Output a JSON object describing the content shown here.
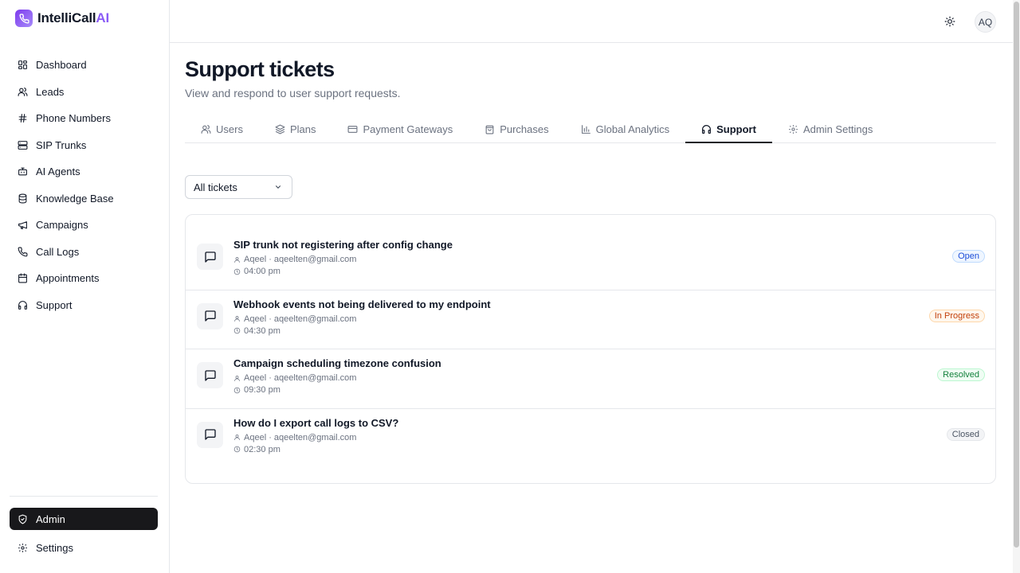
{
  "brand": {
    "name_main": "IntelliCall",
    "name_accent": "AI"
  },
  "sidebar": {
    "items": [
      {
        "label": "Dashboard",
        "icon": "dashboard-icon"
      },
      {
        "label": "Leads",
        "icon": "users-icon"
      },
      {
        "label": "Phone Numbers",
        "icon": "hash-icon"
      },
      {
        "label": "SIP Trunks",
        "icon": "server-icon"
      },
      {
        "label": "AI Agents",
        "icon": "bot-icon"
      },
      {
        "label": "Knowledge Base",
        "icon": "database-icon"
      },
      {
        "label": "Campaigns",
        "icon": "megaphone-icon"
      },
      {
        "label": "Call Logs",
        "icon": "phone-icon"
      },
      {
        "label": "Appointments",
        "icon": "calendar-icon"
      },
      {
        "label": "Support",
        "icon": "headphones-icon"
      }
    ],
    "bottom": [
      {
        "label": "Admin",
        "icon": "shield-icon",
        "active": true
      },
      {
        "label": "Settings",
        "icon": "gear-icon"
      }
    ]
  },
  "topbar": {
    "avatar_initials": "AQ",
    "theme_icon": "sun-icon"
  },
  "page": {
    "title": "Support tickets",
    "subtitle": "View and respond to user support requests."
  },
  "tabs": [
    {
      "label": "Users",
      "icon": "users-icon"
    },
    {
      "label": "Plans",
      "icon": "layers-icon"
    },
    {
      "label": "Payment Gateways",
      "icon": "credit-card-icon"
    },
    {
      "label": "Purchases",
      "icon": "shopping-bag-icon"
    },
    {
      "label": "Global Analytics",
      "icon": "bar-chart-icon"
    },
    {
      "label": "Support",
      "icon": "headphones-icon",
      "active": true
    },
    {
      "label": "Admin Settings",
      "icon": "gear-icon"
    }
  ],
  "filter": {
    "selected": "All tickets"
  },
  "tickets": [
    {
      "subject": "SIP trunk not registering after config change",
      "user": "Aqeel · aqeelten@gmail.com",
      "time": "04:00 pm",
      "status": "Open",
      "status_class": "open"
    },
    {
      "subject": "Webhook events not being delivered to my endpoint",
      "user": "Aqeel · aqeelten@gmail.com",
      "time": "04:30 pm",
      "status": "In Progress",
      "status_class": "progress"
    },
    {
      "subject": "Campaign scheduling timezone confusion",
      "user": "Aqeel · aqeelten@gmail.com",
      "time": "09:30 pm",
      "status": "Resolved",
      "status_class": "resolved"
    },
    {
      "subject": "How do I export call logs to CSV?",
      "user": "Aqeel · aqeelten@gmail.com",
      "time": "02:30 pm",
      "status": "Closed",
      "status_class": "closed"
    }
  ],
  "colors": {
    "accent": "#8b5cf6",
    "active_nav_bg": "#18181b",
    "open": "#1d4ed8",
    "in_progress": "#c2410c",
    "resolved": "#15803d",
    "closed": "#4b5563"
  }
}
